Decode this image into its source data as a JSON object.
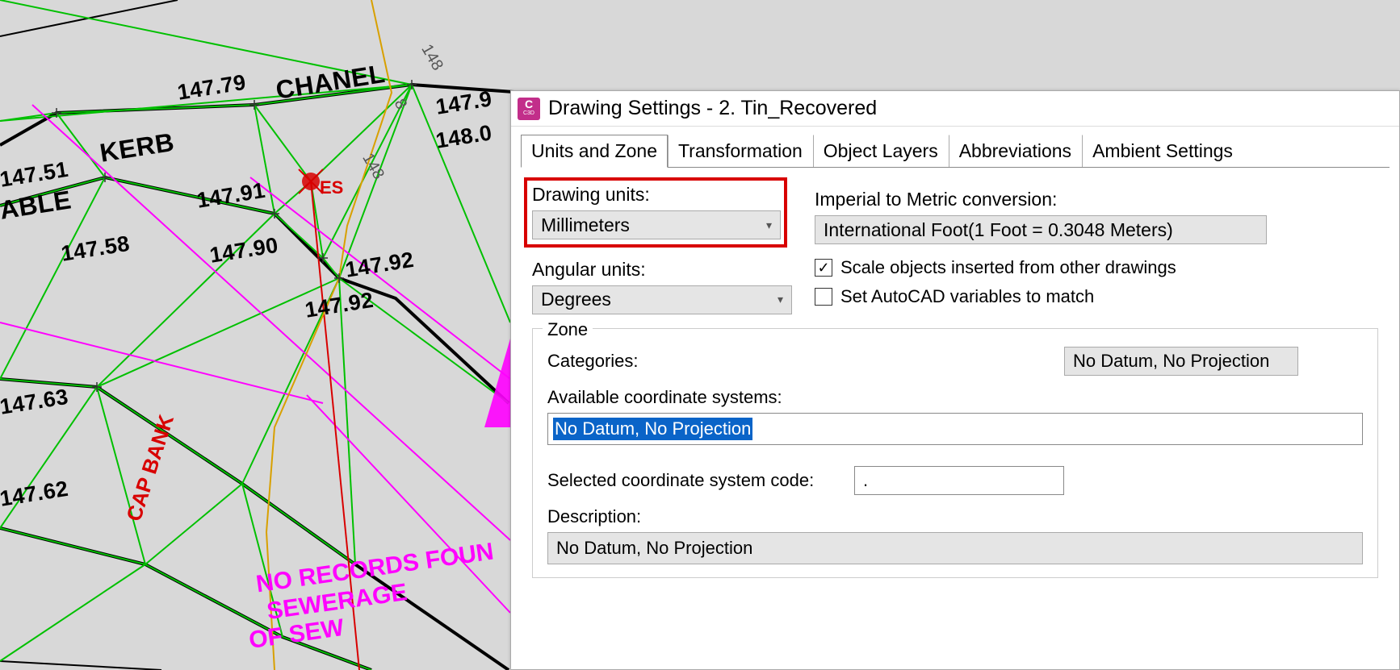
{
  "dialog": {
    "title": "Drawing Settings - 2. Tin_Recovered",
    "icon_main": "C",
    "icon_sub": "C3D",
    "tabs": [
      "Units and Zone",
      "Transformation",
      "Object Layers",
      "Abbreviations",
      "Ambient Settings"
    ],
    "active_tab_index": 0,
    "drawing_units_label": "Drawing units:",
    "drawing_units_value": "Millimeters",
    "angular_units_label": "Angular units:",
    "angular_units_value": "Degrees",
    "conversion_label": "Imperial to Metric conversion:",
    "conversion_value": "International Foot(1 Foot = 0.3048 Meters)",
    "scale_objects_label": "Scale objects inserted from other drawings",
    "scale_objects_checked": true,
    "set_autocad_label": "Set AutoCAD variables to match",
    "set_autocad_checked": false,
    "zone": {
      "title": "Zone",
      "categories_label": "Categories:",
      "categories_value": "No Datum, No Projection",
      "available_label": "Available coordinate systems:",
      "available_value": "No Datum, No Projection",
      "selected_code_label": "Selected coordinate system code:",
      "selected_code_value": ".",
      "description_label": "Description:",
      "description_value": "No Datum, No Projection"
    }
  },
  "drawing": {
    "labels": {
      "kerb": "KERB",
      "chanel": "CHANEL",
      "able": "ABLE",
      "cap_bank": "CAP BANK",
      "es": "ES",
      "no_records_1": "NO RECORDS FOUN",
      "no_records_2": "SEWERAGE",
      "no_records_3": "OF SEW"
    },
    "elevations": {
      "e1": "147.51",
      "e2": "147.79",
      "e3": "147.9",
      "e4": "148.0",
      "e5": "147.91",
      "e6": "147.90",
      "e7": "147.92",
      "e8": "147.92",
      "e9": "147.58",
      "e10": "147.63",
      "e11": "147.62",
      "n1": "148",
      "n2": "8",
      "n3": "148"
    }
  }
}
